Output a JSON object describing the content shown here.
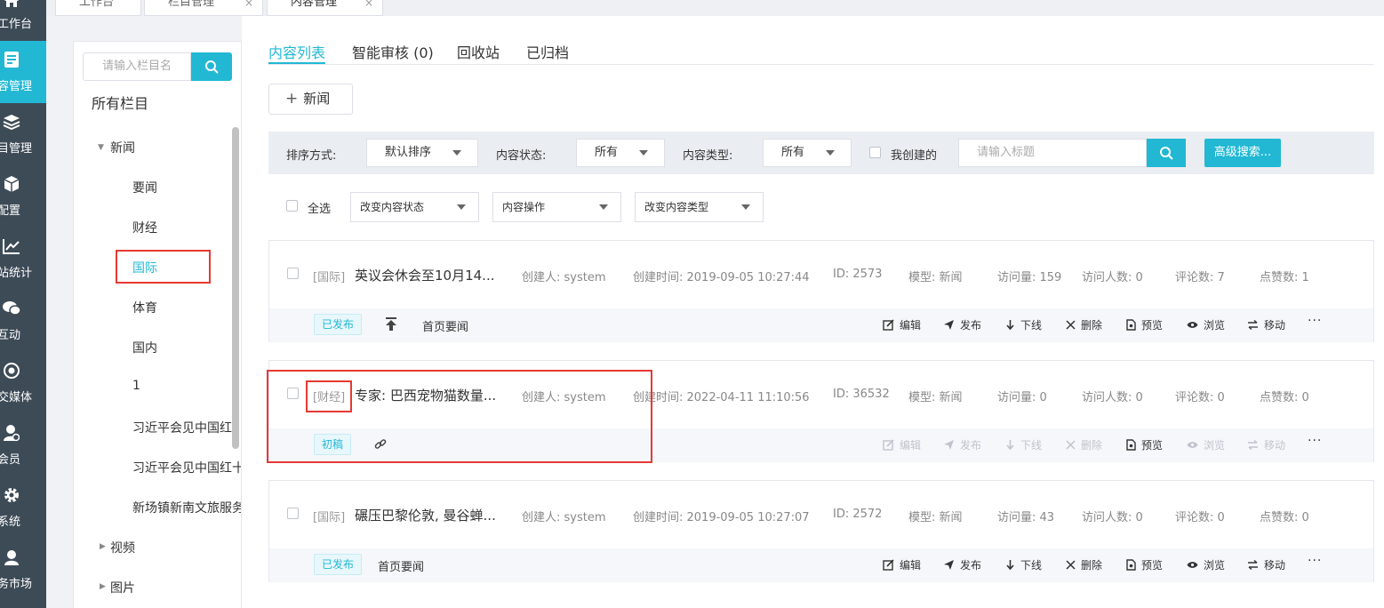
{
  "nav": [
    {
      "label": "工作台",
      "icon": "home-icon"
    },
    {
      "label": "容管理",
      "icon": "content-icon"
    },
    {
      "label": "目管理",
      "icon": "layers-icon"
    },
    {
      "label": "配置",
      "icon": "cube-icon"
    },
    {
      "label": "站统计",
      "icon": "chart-icon"
    },
    {
      "label": "互动",
      "icon": "chat-icon"
    },
    {
      "label": "交媒体",
      "icon": "social-icon"
    },
    {
      "label": "会员",
      "icon": "member-icon"
    },
    {
      "label": "系统",
      "icon": "gear-icon"
    },
    {
      "label": "务市场",
      "icon": "market-icon"
    }
  ],
  "top_tabs": [
    "工作台",
    "栏目管理",
    "内容管理"
  ],
  "tree": {
    "search_placeholder": "请输入栏目名",
    "title": "所有栏目",
    "root": "新闻",
    "children": [
      "要闻",
      "财经",
      "国际",
      "体育",
      "国内",
      "1",
      "习近平会见中国红",
      "习近平会见中国红十",
      "新场镇新南文旅服务"
    ],
    "siblings": [
      "视频",
      "图片"
    ]
  },
  "content_tabs": [
    "内容列表",
    "智能审核 (0)",
    "回收站",
    "已归档"
  ],
  "new_button": "新闻",
  "filters": {
    "sort_label": "排序方式:",
    "sort_value": "默认排序",
    "status_label": "内容状态:",
    "status_value": "所有",
    "type_label": "内容类型:",
    "type_value": "所有",
    "mine_label": "我创建的",
    "title_placeholder": "请输入标题",
    "advanced": "高级搜索..."
  },
  "bulk": {
    "select_all": "全选",
    "change_status": "改变内容状态",
    "operation": "内容操作",
    "change_type": "改变内容类型"
  },
  "actions": [
    "编辑",
    "发布",
    "下线",
    "删除",
    "预览",
    "浏览",
    "移动"
  ],
  "items": [
    {
      "category": "[国际]",
      "title": "英议会休会至10月14...",
      "creator": "创建人: system",
      "created": "创建时间: 2019-09-05 10:27:44",
      "id": "ID: 2573",
      "model": "模型: 新闻",
      "visits": "访问量: 159",
      "visitors": "访问人数: 0",
      "comments": "评论数: 7",
      "likes": "点赞数: 1",
      "status": "已发布",
      "tag": "首页要闻"
    },
    {
      "category": "[财经]",
      "title": "专家: 巴西宠物猫数量...",
      "creator": "创建人: system",
      "created": "创建时间: 2022-04-11 11:10:56",
      "id": "ID: 36532",
      "model": "模型: 新闻",
      "visits": "访问量: 0",
      "visitors": "访问人数: 0",
      "comments": "评论数: 0",
      "likes": "点赞数: 0",
      "status": "初稿",
      "tag": ""
    },
    {
      "category": "[国际]",
      "title": "碾压巴黎伦敦, 曼谷蝉...",
      "creator": "创建人: system",
      "created": "创建时间: 2019-09-05 10:27:07",
      "id": "ID: 2572",
      "model": "模型: 新闻",
      "visits": "访问量: 43",
      "visitors": "访问人数: 0",
      "comments": "评论数: 0",
      "likes": "点赞数: 0",
      "status": "已发布",
      "tag": "首页要闻"
    }
  ],
  "colors": {
    "accent": "#22b8d4",
    "nav_bg": "#3d4b57",
    "highlight": "#e53935"
  }
}
